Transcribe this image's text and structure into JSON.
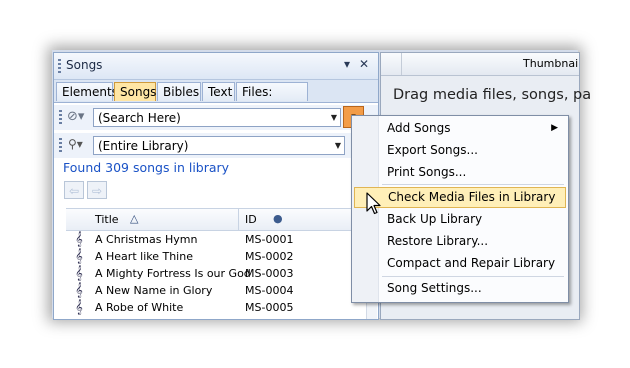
{
  "panel": {
    "title": "Songs",
    "pin_symbol": "▾",
    "close_symbol": "✕"
  },
  "tabs": [
    {
      "label": "Elements"
    },
    {
      "label": "Songs"
    },
    {
      "label": "Bibles"
    },
    {
      "label": "Text"
    },
    {
      "label": "Files: Loops"
    }
  ],
  "search": {
    "value": "(Search Here)"
  },
  "scope": {
    "value": "(Entire Library)"
  },
  "found_text": "Found 309 songs in library",
  "columns": {
    "title": "Title",
    "id": "ID"
  },
  "songs": [
    {
      "title": "A Christmas Hymn",
      "id": "MS-0001"
    },
    {
      "title": "A Heart like Thine",
      "id": "MS-0002"
    },
    {
      "title": "A Mighty Fortress Is our God",
      "id": "MS-0003"
    },
    {
      "title": "A New Name in Glory",
      "id": "MS-0004"
    },
    {
      "title": "A Robe of White",
      "id": "MS-0005"
    }
  ],
  "right_pane": {
    "header": "Thumbnai",
    "drag_text": "Drag media files, songs, pa"
  },
  "menu": {
    "items": [
      {
        "label": "Add Songs",
        "submenu": true
      },
      {
        "label": "Export Songs..."
      },
      {
        "label": "Print Songs..."
      },
      {
        "label": "Check Media Files in Library",
        "highlighted": true
      },
      {
        "label": "Back Up Library"
      },
      {
        "label": "Restore Library..."
      },
      {
        "label": "Compact and Repair Library"
      },
      {
        "label": "Song Settings..."
      }
    ]
  },
  "colors": {
    "accent_tab": "#ffe6a5",
    "menu_highlight": "#ffefb8",
    "found_text": "#1a52c6",
    "dropdown_button": "#f39c47"
  }
}
